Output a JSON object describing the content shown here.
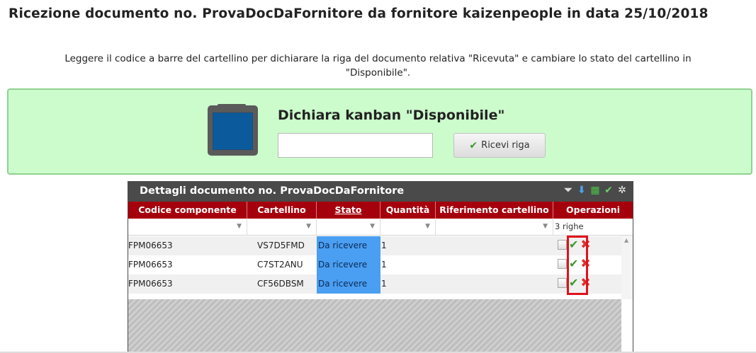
{
  "page_title": "Ricezione documento no. ProvaDocDaFornitore da fornitore kaizenpeople in data 25/10/2018",
  "instructions": {
    "line1": "Leggere il codice a barre del cartellino per dichiarare la riga del documento relativa \"Ricevuta\" e cambiare lo stato del cartellino in",
    "line2": "\"Disponibile\"."
  },
  "scan_panel": {
    "title": "Dichiara kanban \"Disponibile\"",
    "input_value": "",
    "receive_button_label": "Ricevi riga",
    "accent_color": "#ccfccc",
    "kanban_icon_color": "#0b5b9c"
  },
  "grid": {
    "title": "Dettagli documento no. ProvaDocDaFornitore",
    "toolbar_icons": [
      "filter-clear-icon",
      "download-icon",
      "excel-icon",
      "check-icon",
      "gear-icon"
    ],
    "columns": [
      "Codice componente",
      "Cartellino",
      "Stato",
      "Quantità",
      "Riferimento cartellino",
      "Operazioni"
    ],
    "sorted_column": "Stato",
    "row_count_label": "3 righe",
    "rows": [
      {
        "codice": "FPM06653",
        "cartellino": "VS7D5FMD",
        "stato": "Da ricevere",
        "quantita": "1",
        "riferimento": ""
      },
      {
        "codice": "FPM06653",
        "cartellino": "C7ST2ANU",
        "stato": "Da ricevere",
        "quantita": "1",
        "riferimento": ""
      },
      {
        "codice": "FPM06653",
        "cartellino": "CF56DBSM",
        "stato": "Da ricevere",
        "quantita": "1",
        "riferimento": ""
      }
    ],
    "row_operation_icons": [
      "document-icon",
      "confirm-check-icon",
      "delete-x-icon"
    ],
    "header_color": "#a5010c",
    "stato_cell_color": "#4a9ff2"
  }
}
